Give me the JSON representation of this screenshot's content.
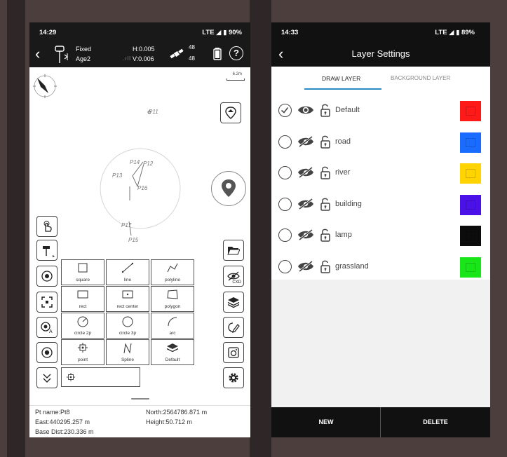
{
  "left_screen": {
    "status": {
      "time": "14:29",
      "network": "LTE ◢ ▮ 90%"
    },
    "gnss": {
      "solution": "Fixed",
      "age": "Age2",
      "h_precision": "H:0.005",
      "v_precision": "V:0.006",
      "sat_count_1": "48",
      "sat_count_2": "48"
    },
    "map": {
      "scale": "6.2m",
      "points": [
        "P11",
        "P14",
        "P12",
        "P13",
        "P16",
        "P17",
        "P15"
      ]
    },
    "draw_tools": {
      "square": "square",
      "line": "line",
      "polyline": "polyline",
      "rect": "rect",
      "rect_center": "rect center",
      "polygon": "polygon",
      "circle_2p": "circle 2p",
      "circle_3p": "circle 3p",
      "arc": "arc",
      "point": "point",
      "spline": "Spline",
      "default_layer": "Default"
    },
    "eye_sub_label": "CXD",
    "info": {
      "pt_name": "Pt name:Pt8",
      "north": "North:2564786.871 m",
      "east": "East:440295.257 m",
      "height": "Height:50.712 m",
      "base_dist": "Base Dist:230.336 m"
    }
  },
  "right_screen": {
    "status": {
      "time": "14:33",
      "network": "LTE ◢ ▮ 89%"
    },
    "title": "Layer Settings",
    "tabs": {
      "draw": "DRAW LAYER",
      "background": "BACKGROUND LAYER"
    },
    "layers": [
      {
        "name": "Default",
        "color": "#ff1a1a",
        "checked": true,
        "visible": true
      },
      {
        "name": "road",
        "color": "#1a6cff",
        "checked": false,
        "visible": false
      },
      {
        "name": "river",
        "color": "#ffd400",
        "checked": false,
        "visible": false
      },
      {
        "name": "building",
        "color": "#4a12e8",
        "checked": false,
        "visible": false
      },
      {
        "name": "lamp",
        "color": "#0c0c0c",
        "checked": false,
        "visible": false
      },
      {
        "name": "grassland",
        "color": "#19e619",
        "checked": false,
        "visible": false
      }
    ],
    "buttons": {
      "new": "NEW",
      "delete": "DELETE"
    }
  },
  "colors": {
    "accent_tab": "#2b8cc4",
    "bar_dark": "#111111"
  }
}
